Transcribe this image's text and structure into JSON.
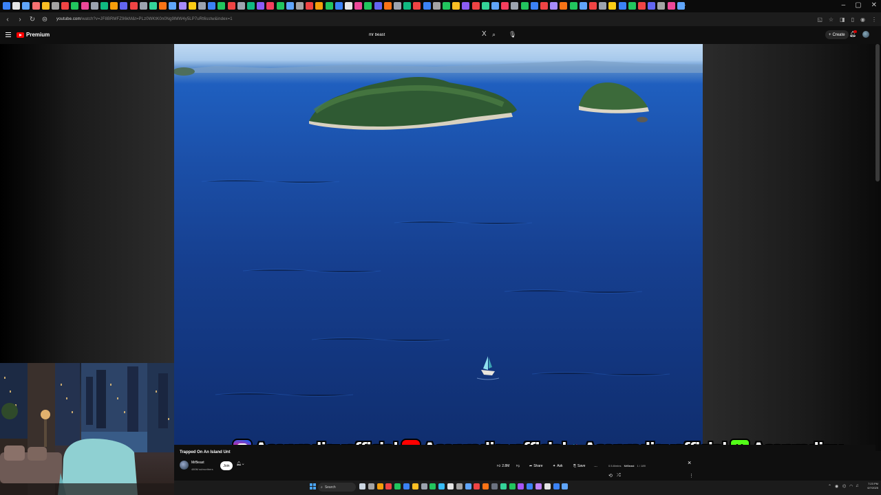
{
  "browser": {
    "tab_colors": [
      "#3b82f6",
      "#e5e5e5",
      "#60a5fa",
      "#f87171",
      "#fbbf24",
      "#a3a3a3",
      "#ef4444",
      "#22c55e",
      "#ec4899",
      "#9ca3af",
      "#10b981",
      "#f59e0b",
      "#6366f1",
      "#ef4444",
      "#9ca3af",
      "#34d399",
      "#f97316",
      "#60a5fa",
      "#a78bfa",
      "#facc15",
      "#9ca3af",
      "#3b82f6",
      "#22c55e",
      "#ef4444",
      "#9ca3af",
      "#10b981",
      "#8b5cf6",
      "#f43f5e",
      "#22c55e",
      "#60a5fa",
      "#a3a3a3",
      "#ef4444",
      "#f59e0b",
      "#22c55e",
      "#3b82f6",
      "#e5e5e5",
      "#ec4899",
      "#22c55e",
      "#6366f1",
      "#f97316",
      "#9ca3af",
      "#10b981",
      "#ef4444",
      "#3b82f6",
      "#a3a3a3",
      "#22c55e",
      "#fbbf24",
      "#8b5cf6",
      "#ef4444",
      "#34d399",
      "#60a5fa",
      "#f43f5e",
      "#9ca3af",
      "#22c55e",
      "#3b82f6",
      "#ef4444",
      "#a78bfa",
      "#f97316",
      "#22c55e",
      "#60a5fa",
      "#ef4444",
      "#9ca3af",
      "#facc15",
      "#3b82f6",
      "#22c55e",
      "#ef4444",
      "#6366f1",
      "#a3a3a3",
      "#ec4899",
      "#60a5fa"
    ],
    "new_tab": "+",
    "window_controls": [
      "–",
      "▢",
      "✕"
    ],
    "url_host": "youtube.com",
    "url_path": "/watch?v=JF8BRMFZ96kM&t=PLz0WKtK0n0Ng9lMW4y5LP7uRt6sstw&index=1"
  },
  "youtube": {
    "logo_text": "Premium",
    "search_value": "mr beast",
    "search_clear": "X",
    "create_label": "Create"
  },
  "overlay": {
    "handles": [
      "Aceprodigyofficial",
      "Aceprodigyofficial",
      "Aceprodigyofficial",
      "Aceprodigy"
    ],
    "kick_letter": "K"
  },
  "video_info": {
    "title": "Trapped On An Island Unt",
    "channel": "MrBeast",
    "subscribers": "480M subscribers",
    "join_label": "Join",
    "like_count": "2.8M",
    "share_label": "Share",
    "ask_label": "Ask",
    "save_label": "Save",
    "more": "…",
    "close": "×",
    "mini_line1": "0.5.8/mins",
    "mini_channel": "MrBeast",
    "mini_progress": "1 / 189",
    "mini_kebab": "⋮"
  },
  "taskbar": {
    "search_label": "Search",
    "time": "7:23 PM",
    "date": "6/7/2025",
    "icon_colors": [
      "#cbd5e1",
      "#a3a3a3",
      "#f59e0b",
      "#ef4444",
      "#22c55e",
      "#3b82f6",
      "#fbbf24",
      "#9ca3af",
      "#22c55e",
      "#38bdf8",
      "#e5e5e5",
      "#a3a3a3",
      "#60a5fa",
      "#ef4444",
      "#f97316",
      "#6b7280",
      "#34d399",
      "#22c55e",
      "#a855f7",
      "#3b82f6",
      "#c084fc",
      "#e5e5e5",
      "#3b82f6",
      "#60a5fa"
    ]
  }
}
